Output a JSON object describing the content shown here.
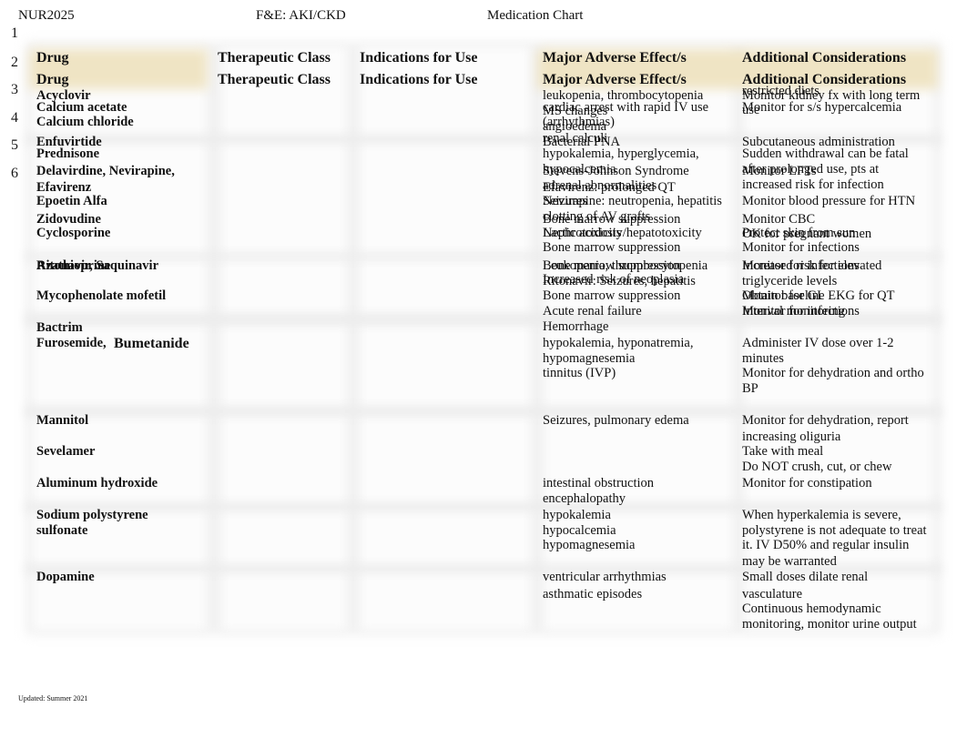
{
  "header": {
    "course": "NUR2025",
    "topic": "F&E: AKI/CKD",
    "title": "Medication Chart"
  },
  "line_numbers": [
    "1",
    "2",
    "3",
    "4",
    "5",
    "6"
  ],
  "columns": [
    "Drug",
    "Therapeutic Class",
    "Indications for Use",
    "Major Adverse Effect/s",
    "Additional Considerations"
  ],
  "drugs": [
    "Acyclovir",
    "Calcium acetate",
    "Calcium chloride",
    "Enfuvirtide",
    "Prednisone",
    "Delavirdine, Nevirapine,",
    "Efavirenz",
    "Epoetin Alfa",
    "Zidovudine",
    "Cyclosporine",
    "Azathioprine",
    "Ritonavir, Saquinavir",
    "Mycophenolate mofetil",
    "Bactrim",
    "Furosemide,",
    "Bumetanide",
    "Mannitol",
    "Sevelamer",
    "Aluminum hydroxide",
    "Sodium polystyrene",
    "sulfonate",
    "Dopamine"
  ],
  "adverse": [
    "leukopenia, thrombocytopenia",
    "cardiac arrest with rapid IV use",
    "MS changes",
    "(arrhythmias)",
    "angioedema",
    "renal calculi",
    "Bacterial PNA",
    "hypokalemia, hyperglycemia,",
    "hypocalcemia",
    "Stevens-Johnson Syndrome",
    "adrenal abnormalities",
    "Efavirenz: prolonged QT",
    "Seizures",
    "Nevirapine: neutropenia, hepatitis",
    "clotting of AV grafts",
    "Bone marrow suppression",
    "Lactic acidosis",
    "Nephrotoxicity/hepatotoxicity",
    "Bone marrow suppression",
    "Bone marrow suppression",
    "Leukopenia, thrombocytopenia",
    "Increased risk of neoplasia",
    "Ritonavir: Seizures, hepatitis",
    "Bone marrow suppression",
    "Acute renal failure",
    "Hemorrhage",
    "hypokalemia, hyponatremia,",
    "hypomagnesemia",
    "tinnitus (IVP)",
    "Seizures, pulmonary edema",
    "intestinal obstruction",
    "encephalopathy",
    "hypokalemia",
    "hypocalcemia",
    "hypomagnesemia",
    "ventricular arrhythmias",
    "asthmatic episodes"
  ],
  "considerations": [
    "restricted diets",
    "Monitor kidney fx with long term",
    "use",
    "Monitor for s/s hypercalcemia",
    "Subcutaneous administration",
    "Sudden withdrawal can be fatal",
    "after prolonged use, pts at",
    "Monitor LFTs",
    "increased risk for infection",
    "Monitor blood pressure for HTN",
    "Monitor CBC",
    "Protect skin from sun",
    "OK for pregnant women",
    "Monitor for infections",
    "Monitor for infections",
    "Increased risk for elevated",
    "triglyceride levels",
    "Obtain baseline EKG for QT",
    "Monitor for GI",
    "Interval monitoring",
    "Monitor for infections",
    "Administer IV dose over 1-2",
    "minutes",
    "Monitor for dehydration and ortho",
    "BP",
    "Monitor for dehydration, report",
    "increasing oliguria",
    "Take with meal",
    "Do NOT crush, cut, or chew",
    "Monitor for constipation",
    "When hyperkalemia is severe,",
    "polystyrene is not adequate to treat",
    "it. IV D50% and regular insulin",
    "may be warranted",
    "Small doses dilate renal",
    "vasculature",
    "Continuous hemodynamic",
    "monitoring, monitor urine output"
  ],
  "footer": "Updated: Summer 2021",
  "colors": {
    "header_tint": "#efe4c4",
    "table_shade": "#f2f2f2"
  }
}
